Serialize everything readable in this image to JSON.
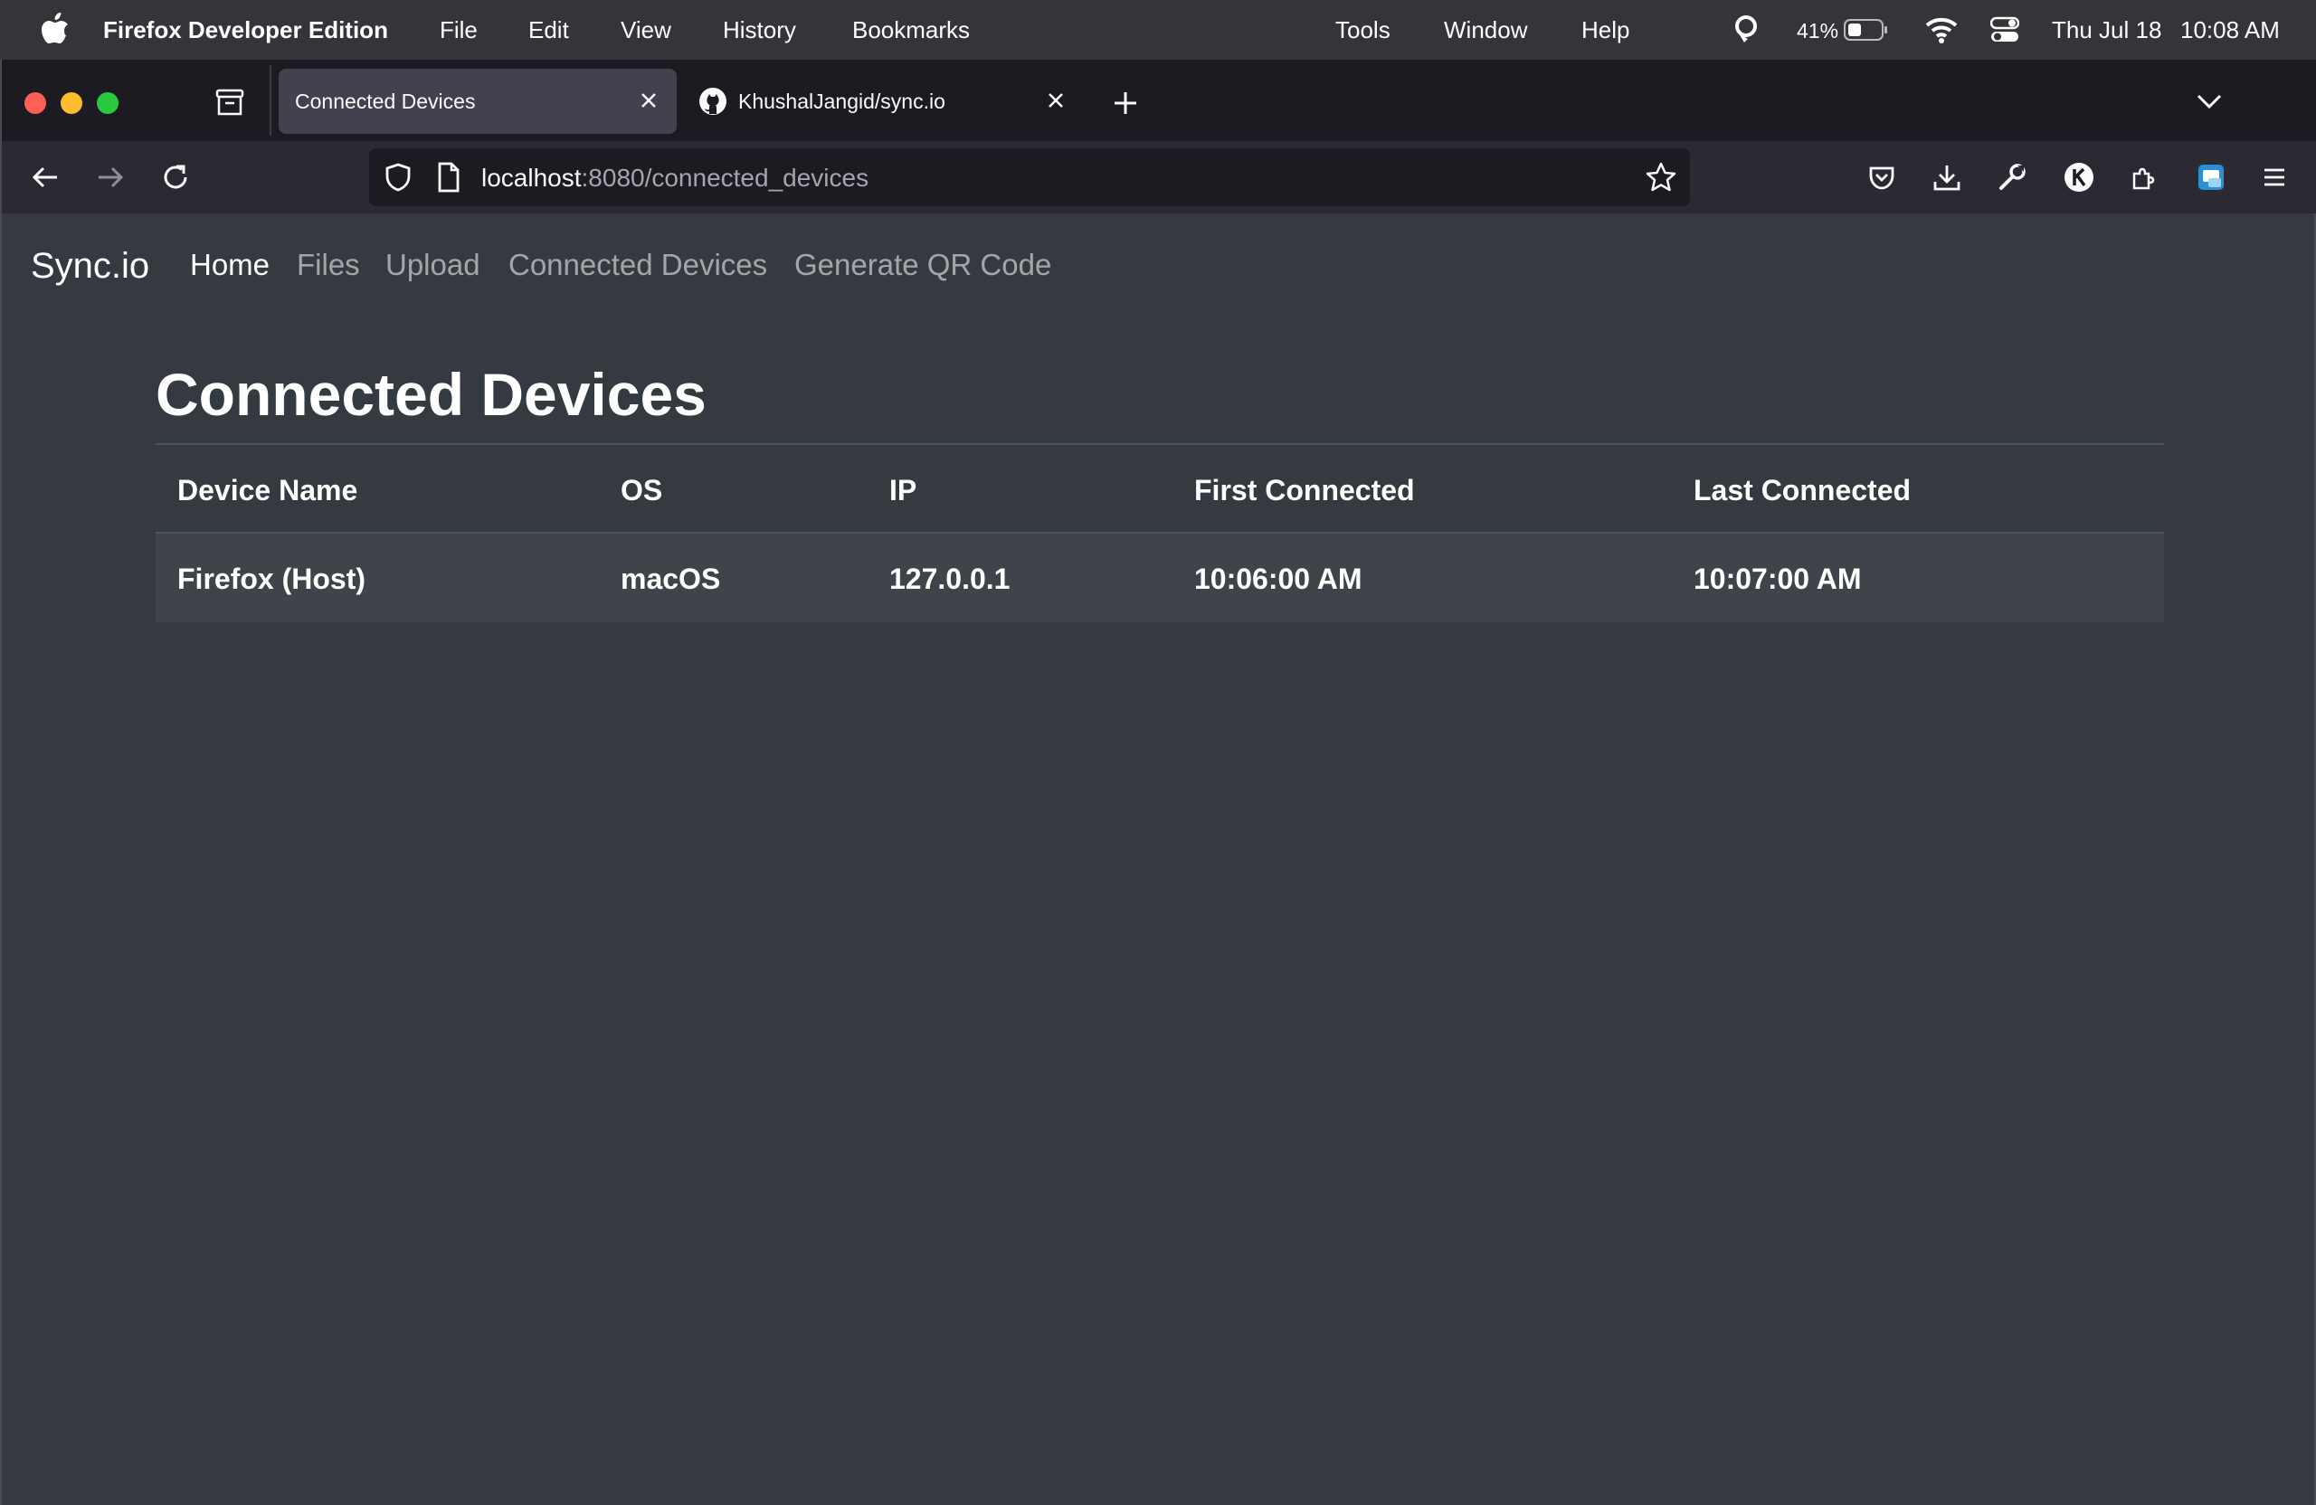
{
  "menubar": {
    "app_name": "Firefox Developer Edition",
    "menus": [
      "File",
      "Edit",
      "View",
      "History",
      "Bookmarks",
      "Tools",
      "Window",
      "Help"
    ],
    "battery_percent": "41%",
    "battery_level": 0.41,
    "date": "Thu Jul 18",
    "time": "10:08 AM"
  },
  "tabs": [
    {
      "label": "Connected Devices",
      "active": true
    },
    {
      "label": "KhushalJangid/sync.io",
      "active": false
    }
  ],
  "url": {
    "host": "localhost",
    "rest": ":8080/connected_devices"
  },
  "site": {
    "brand": "Sync.io",
    "nav": [
      "Home",
      "Files",
      "Upload",
      "Connected Devices",
      "Generate QR Code"
    ],
    "active_nav": "Home"
  },
  "page": {
    "title": "Connected Devices",
    "table": {
      "columns": [
        "Device Name",
        "OS",
        "IP",
        "First Connected",
        "Last Connected"
      ],
      "rows": [
        [
          "Firefox (Host)",
          "macOS",
          "127.0.0.1",
          "10:06:00 AM",
          "10:07:00 AM"
        ]
      ]
    }
  },
  "colors": {
    "page_bg": "#343a40",
    "row_bg": "#3e444a",
    "browser_bg": "#1c1b22",
    "toolbar_bg": "#2b2a33"
  },
  "icons": [
    "apple-icon",
    "lock-icon",
    "wifi-icon",
    "control-center-icon",
    "tab-manager-icon",
    "github-icon",
    "back-icon",
    "forward-icon",
    "reload-icon",
    "shield-icon",
    "page-icon",
    "star-icon",
    "pocket-icon",
    "download-icon",
    "wrench-icon",
    "account-icon",
    "extensions-icon",
    "menu-icon"
  ]
}
